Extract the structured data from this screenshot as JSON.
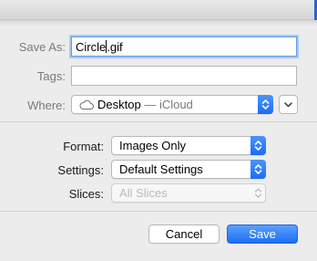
{
  "save_as": {
    "label": "Save As:",
    "value_before_caret": "Circle",
    "value_after_caret": ".gif"
  },
  "tags": {
    "label": "Tags:",
    "value": ""
  },
  "where": {
    "label": "Where:",
    "location": "Desktop",
    "separator": " — ",
    "service": "iCloud",
    "icon": "cloud-icon"
  },
  "format": {
    "label": "Format:",
    "value": "Images Only"
  },
  "settings": {
    "label": "Settings:",
    "value": "Default Settings"
  },
  "slices": {
    "label": "Slices:",
    "value": "All Slices",
    "enabled": false
  },
  "buttons": {
    "cancel": "Cancel",
    "save": "Save"
  },
  "colors": {
    "accent": "#1d6ff3",
    "background": "#ececec"
  }
}
